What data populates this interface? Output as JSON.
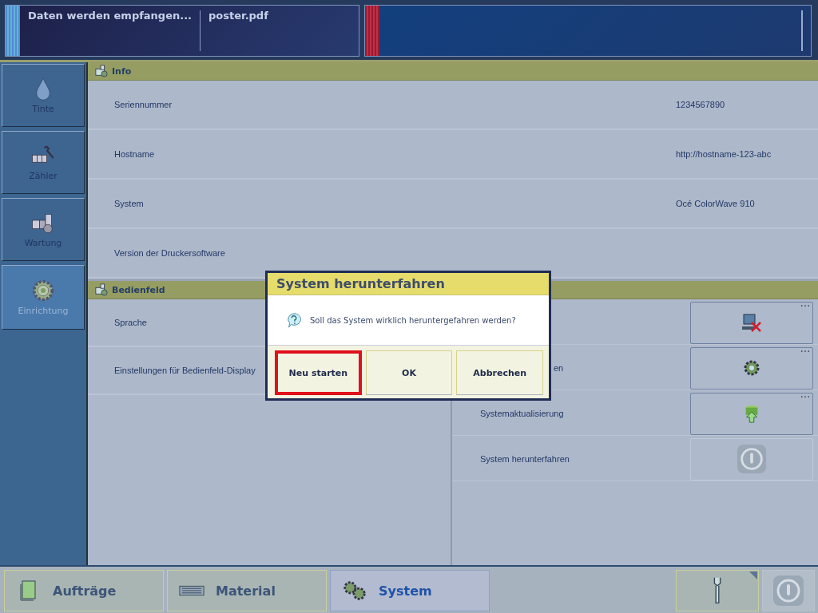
{
  "top_bar": {
    "job_status": "Daten werden empfangen...",
    "job_name": "poster.pdf"
  },
  "sidebar": {
    "items": [
      {
        "label": "Tinte",
        "selected": false
      },
      {
        "label": "Zähler",
        "selected": false
      },
      {
        "label": "Wartung",
        "selected": false
      },
      {
        "label": "Einrichtung",
        "selected": true
      }
    ]
  },
  "info": {
    "title": "Info",
    "rows": [
      {
        "label": "Seriennummer",
        "value": "1234567890"
      },
      {
        "label": "Hostname",
        "value": "http://hostname-123-abc"
      },
      {
        "label": "System",
        "value": "Océ ColorWave 910"
      },
      {
        "label": "Version der Druckersoftware"
      }
    ]
  },
  "bedienfeld": {
    "title": "Bedienfeld",
    "rows": [
      {
        "label": "Sprache"
      },
      {
        "label": "Einstellungen für Bedienfeld-Display"
      }
    ]
  },
  "actions": {
    "rows": [
      {
        "enabled": true
      },
      {
        "label": "en",
        "partial": true,
        "enabled": true
      },
      {
        "label": "Systemaktualisierung",
        "enabled": true
      },
      {
        "label": "System herunterfahren",
        "enabled": false
      }
    ]
  },
  "dialog": {
    "title": "System herunterfahren",
    "message": "Soll das System wirklich heruntergefahren werden?",
    "buttons": [
      {
        "label": "Neu starten",
        "highlighted": true
      },
      {
        "label": "OK",
        "highlighted": false
      },
      {
        "label": "Abbrechen",
        "highlighted": false
      }
    ]
  },
  "bottom_tabs": [
    {
      "label": "Aufträge",
      "selected": false
    },
    {
      "label": "Material",
      "selected": false
    },
    {
      "label": "System",
      "selected": true
    }
  ],
  "bottom_tools": [
    {
      "enabled": true
    },
    {
      "enabled": false
    }
  ]
}
